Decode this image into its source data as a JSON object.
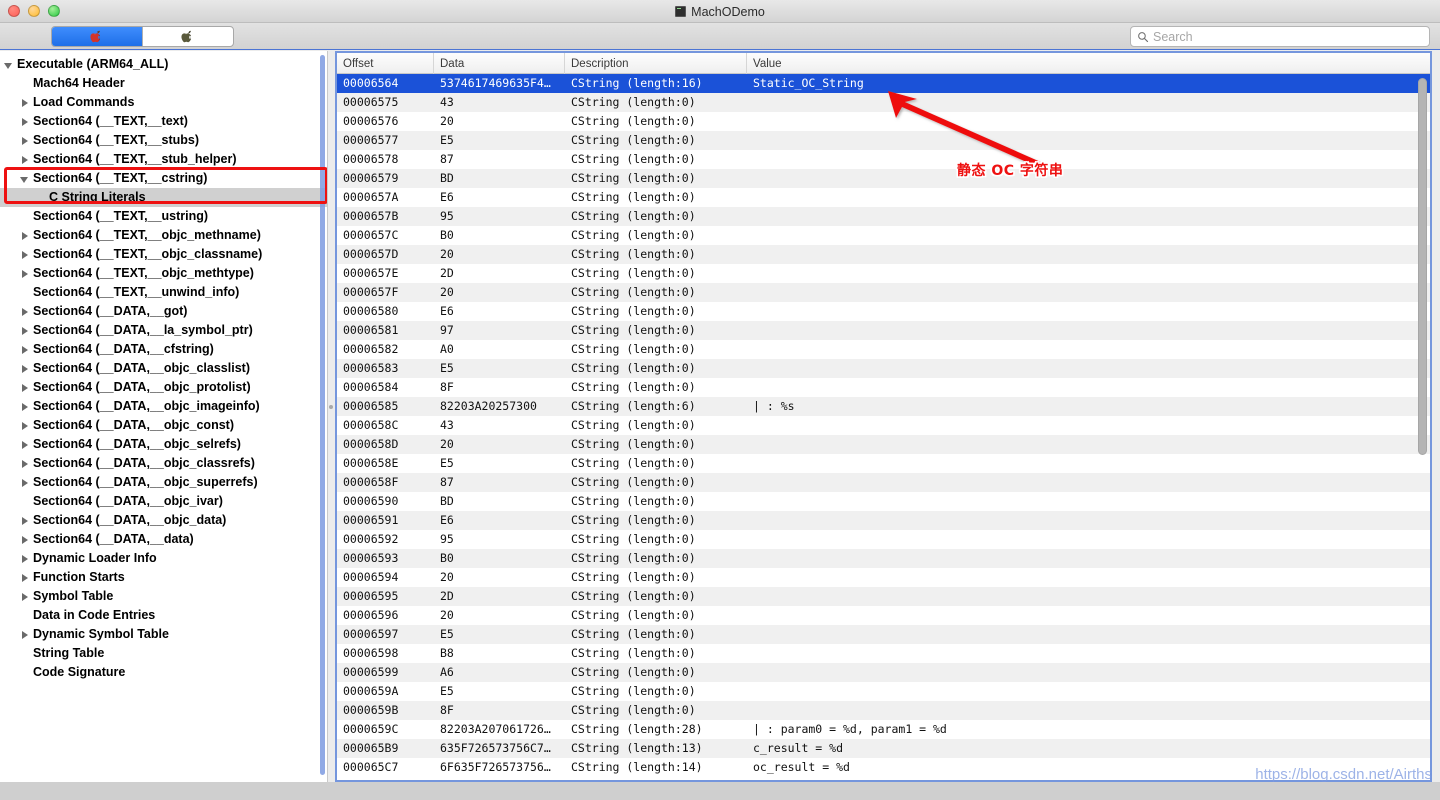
{
  "window": {
    "title": "MachODemo",
    "traffic_lights": [
      "close",
      "minimize",
      "maximize"
    ]
  },
  "toolbar": {
    "segmented": [
      {
        "name": "arch-arm64-button",
        "icon": "red-apple-icon",
        "selected": true
      },
      {
        "name": "arch-other-button",
        "icon": "dark-apple-icon",
        "selected": false
      }
    ],
    "search": {
      "placeholder": "Search",
      "value": "",
      "icon": "search-icon"
    }
  },
  "sidebar": {
    "items": [
      {
        "label": "Executable  (ARM64_ALL)",
        "indent": 0,
        "twisty": "open",
        "selected": false
      },
      {
        "label": "Mach64 Header",
        "indent": 1,
        "twisty": "none",
        "selected": false
      },
      {
        "label": "Load Commands",
        "indent": 1,
        "twisty": "closed",
        "selected": false
      },
      {
        "label": "Section64 (__TEXT,__text)",
        "indent": 1,
        "twisty": "closed",
        "selected": false
      },
      {
        "label": "Section64 (__TEXT,__stubs)",
        "indent": 1,
        "twisty": "closed",
        "selected": false
      },
      {
        "label": "Section64 (__TEXT,__stub_helper)",
        "indent": 1,
        "twisty": "closed",
        "selected": false
      },
      {
        "label": "Section64 (__TEXT,__cstring)",
        "indent": 1,
        "twisty": "open",
        "selected": false
      },
      {
        "label": "C String Literals",
        "indent": 2,
        "twisty": "none",
        "selected": true
      },
      {
        "label": "Section64 (__TEXT,__ustring)",
        "indent": 1,
        "twisty": "none",
        "selected": false
      },
      {
        "label": "Section64 (__TEXT,__objc_methname)",
        "indent": 1,
        "twisty": "closed",
        "selected": false
      },
      {
        "label": "Section64 (__TEXT,__objc_classname)",
        "indent": 1,
        "twisty": "closed",
        "selected": false
      },
      {
        "label": "Section64 (__TEXT,__objc_methtype)",
        "indent": 1,
        "twisty": "closed",
        "selected": false
      },
      {
        "label": "Section64 (__TEXT,__unwind_info)",
        "indent": 1,
        "twisty": "none",
        "selected": false
      },
      {
        "label": "Section64 (__DATA,__got)",
        "indent": 1,
        "twisty": "closed",
        "selected": false
      },
      {
        "label": "Section64 (__DATA,__la_symbol_ptr)",
        "indent": 1,
        "twisty": "closed",
        "selected": false
      },
      {
        "label": "Section64 (__DATA,__cfstring)",
        "indent": 1,
        "twisty": "closed",
        "selected": false
      },
      {
        "label": "Section64 (__DATA,__objc_classlist)",
        "indent": 1,
        "twisty": "closed",
        "selected": false
      },
      {
        "label": "Section64 (__DATA,__objc_protolist)",
        "indent": 1,
        "twisty": "closed",
        "selected": false
      },
      {
        "label": "Section64 (__DATA,__objc_imageinfo)",
        "indent": 1,
        "twisty": "closed",
        "selected": false
      },
      {
        "label": "Section64 (__DATA,__objc_const)",
        "indent": 1,
        "twisty": "closed",
        "selected": false
      },
      {
        "label": "Section64 (__DATA,__objc_selrefs)",
        "indent": 1,
        "twisty": "closed",
        "selected": false
      },
      {
        "label": "Section64 (__DATA,__objc_classrefs)",
        "indent": 1,
        "twisty": "closed",
        "selected": false
      },
      {
        "label": "Section64 (__DATA,__objc_superrefs)",
        "indent": 1,
        "twisty": "closed",
        "selected": false
      },
      {
        "label": "Section64 (__DATA,__objc_ivar)",
        "indent": 1,
        "twisty": "none",
        "selected": false
      },
      {
        "label": "Section64 (__DATA,__objc_data)",
        "indent": 1,
        "twisty": "closed",
        "selected": false
      },
      {
        "label": "Section64 (__DATA,__data)",
        "indent": 1,
        "twisty": "closed",
        "selected": false
      },
      {
        "label": "Dynamic Loader Info",
        "indent": 1,
        "twisty": "closed",
        "selected": false
      },
      {
        "label": "Function Starts",
        "indent": 1,
        "twisty": "closed",
        "selected": false
      },
      {
        "label": "Symbol Table",
        "indent": 1,
        "twisty": "closed",
        "selected": false
      },
      {
        "label": "Data in Code Entries",
        "indent": 1,
        "twisty": "none",
        "selected": false
      },
      {
        "label": "Dynamic Symbol Table",
        "indent": 1,
        "twisty": "closed",
        "selected": false
      },
      {
        "label": "String Table",
        "indent": 1,
        "twisty": "none",
        "selected": false
      },
      {
        "label": "Code Signature",
        "indent": 1,
        "twisty": "none",
        "selected": false
      }
    ]
  },
  "table": {
    "columns": [
      "Offset",
      "Data",
      "Description",
      "Value"
    ],
    "rows": [
      {
        "offset": "00006564",
        "data": "5374617469635F4…",
        "description": "CString (length:16)",
        "value": "Static_OC_String",
        "selected": true
      },
      {
        "offset": "00006575",
        "data": "43",
        "description": "CString (length:0)",
        "value": ""
      },
      {
        "offset": "00006576",
        "data": "20",
        "description": "CString (length:0)",
        "value": ""
      },
      {
        "offset": "00006577",
        "data": "E5",
        "description": "CString (length:0)",
        "value": ""
      },
      {
        "offset": "00006578",
        "data": "87",
        "description": "CString (length:0)",
        "value": ""
      },
      {
        "offset": "00006579",
        "data": "BD",
        "description": "CString (length:0)",
        "value": ""
      },
      {
        "offset": "0000657A",
        "data": "E6",
        "description": "CString (length:0)",
        "value": ""
      },
      {
        "offset": "0000657B",
        "data": "95",
        "description": "CString (length:0)",
        "value": ""
      },
      {
        "offset": "0000657C",
        "data": "B0",
        "description": "CString (length:0)",
        "value": ""
      },
      {
        "offset": "0000657D",
        "data": "20",
        "description": "CString (length:0)",
        "value": ""
      },
      {
        "offset": "0000657E",
        "data": "2D",
        "description": "CString (length:0)",
        "value": ""
      },
      {
        "offset": "0000657F",
        "data": "20",
        "description": "CString (length:0)",
        "value": ""
      },
      {
        "offset": "00006580",
        "data": "E6",
        "description": "CString (length:0)",
        "value": ""
      },
      {
        "offset": "00006581",
        "data": "97",
        "description": "CString (length:0)",
        "value": ""
      },
      {
        "offset": "00006582",
        "data": "A0",
        "description": "CString (length:0)",
        "value": ""
      },
      {
        "offset": "00006583",
        "data": "E5",
        "description": "CString (length:0)",
        "value": ""
      },
      {
        "offset": "00006584",
        "data": "8F",
        "description": "CString (length:0)",
        "value": ""
      },
      {
        "offset": "00006585",
        "data": "82203A20257300",
        "description": "CString (length:6)",
        "value": "|  : %s"
      },
      {
        "offset": "0000658C",
        "data": "43",
        "description": "CString (length:0)",
        "value": ""
      },
      {
        "offset": "0000658D",
        "data": "20",
        "description": "CString (length:0)",
        "value": ""
      },
      {
        "offset": "0000658E",
        "data": "E5",
        "description": "CString (length:0)",
        "value": ""
      },
      {
        "offset": "0000658F",
        "data": "87",
        "description": "CString (length:0)",
        "value": ""
      },
      {
        "offset": "00006590",
        "data": "BD",
        "description": "CString (length:0)",
        "value": ""
      },
      {
        "offset": "00006591",
        "data": "E6",
        "description": "CString (length:0)",
        "value": ""
      },
      {
        "offset": "00006592",
        "data": "95",
        "description": "CString (length:0)",
        "value": ""
      },
      {
        "offset": "00006593",
        "data": "B0",
        "description": "CString (length:0)",
        "value": ""
      },
      {
        "offset": "00006594",
        "data": "20",
        "description": "CString (length:0)",
        "value": ""
      },
      {
        "offset": "00006595",
        "data": "2D",
        "description": "CString (length:0)",
        "value": ""
      },
      {
        "offset": "00006596",
        "data": "20",
        "description": "CString (length:0)",
        "value": ""
      },
      {
        "offset": "00006597",
        "data": "E5",
        "description": "CString (length:0)",
        "value": ""
      },
      {
        "offset": "00006598",
        "data": "B8",
        "description": "CString (length:0)",
        "value": ""
      },
      {
        "offset": "00006599",
        "data": "A6",
        "description": "CString (length:0)",
        "value": ""
      },
      {
        "offset": "0000659A",
        "data": "E5",
        "description": "CString (length:0)",
        "value": ""
      },
      {
        "offset": "0000659B",
        "data": "8F",
        "description": "CString (length:0)",
        "value": ""
      },
      {
        "offset": "0000659C",
        "data": "82203A207061726…",
        "description": "CString (length:28)",
        "value": "|  : param0 = %d, param1 = %d"
      },
      {
        "offset": "000065B9",
        "data": "635F726573756C7…",
        "description": "CString (length:13)",
        "value": "c_result = %d"
      },
      {
        "offset": "000065C7",
        "data": "6F635F726573756…",
        "description": "CString (length:14)",
        "value": "oc_result = %d"
      }
    ]
  },
  "annotation": {
    "text": "静态 OC 字符串",
    "color": "#ee1111",
    "arrow": "red-arrow-icon",
    "highlight_box_color": "#ee1111"
  },
  "watermark": {
    "text": "https://blog.csdn.net/Airths",
    "color": "#7d9ae0"
  }
}
